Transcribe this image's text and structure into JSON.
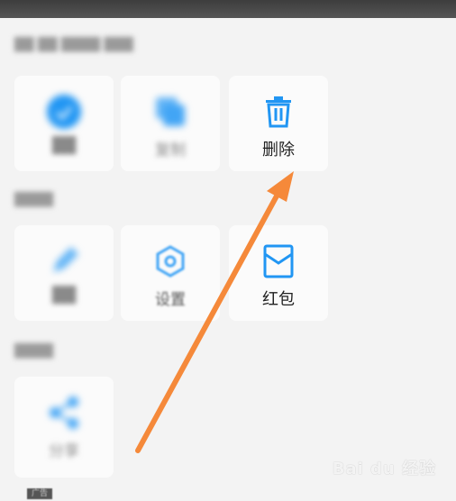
{
  "sections": [
    {
      "title": "██ ██ ████ ███"
    },
    {
      "title": "████"
    },
    {
      "title": "████"
    }
  ],
  "tiles": {
    "tile_1": {
      "label": "██",
      "icon": "circle-icon"
    },
    "tile_2": {
      "label": "复制",
      "icon": "copy-icon"
    },
    "delete": {
      "label": "删除",
      "icon": "trash-icon"
    },
    "tile_4": {
      "label": "██",
      "icon": "pencil-icon"
    },
    "settings": {
      "label": "设置",
      "icon": "hexagon-settings-icon"
    },
    "red_packet": {
      "label": "红包",
      "icon": "red-packet-icon"
    },
    "share": {
      "label": "分享",
      "icon": "share-icon"
    }
  },
  "watermark": {
    "text": "Bai du 经验"
  },
  "ad": {
    "label": "广告"
  },
  "colors": {
    "accent": "#2196f3",
    "arrow": "#f5893a"
  }
}
